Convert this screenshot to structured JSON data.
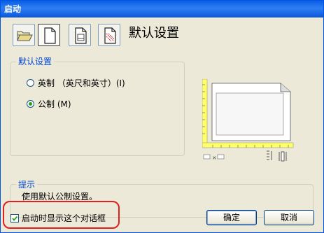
{
  "window": {
    "title": "启动"
  },
  "toolbar": {
    "buttons": [
      {
        "icon": "open-drawing-icon"
      },
      {
        "icon": "default-settings-icon"
      },
      {
        "icon": "use-template-icon"
      },
      {
        "icon": "use-wizard-icon"
      }
    ],
    "selected_index": 1
  },
  "heading": "默认设置",
  "settings_group": {
    "legend": "默认设置",
    "options": [
      {
        "label": "英制 （英尺和英寸）(I)",
        "selected": false
      },
      {
        "label": "公制 (M)",
        "selected": true
      }
    ]
  },
  "hint": {
    "legend": "提示",
    "text": "使用默认公制设置。"
  },
  "show_on_startup": {
    "label": "启动时显示这个对话框",
    "checked": true
  },
  "buttons": {
    "ok": "确定",
    "cancel": "取消"
  },
  "colors": {
    "title_bar": "#0a5ee6",
    "dialog_bg": "#ece9d8",
    "group_label": "#0046d5",
    "highlight": "#e02020",
    "ruler": "#ffff66"
  }
}
